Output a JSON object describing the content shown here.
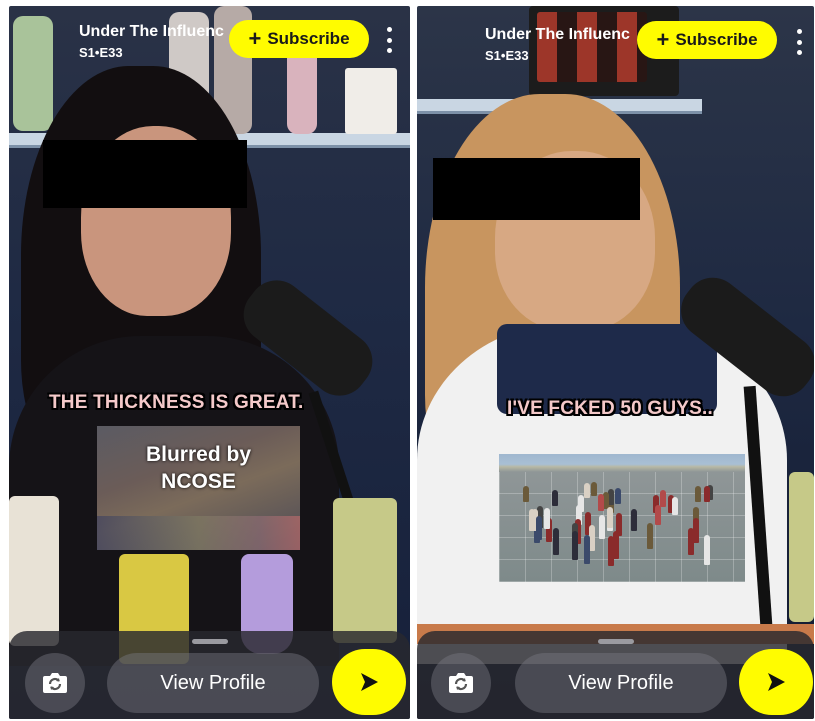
{
  "panels": [
    {
      "show_title": "Under The Influenc",
      "episode": "S1•E33",
      "subscribe_label": "Subscribe",
      "subscribe_plus": "+",
      "caption": "THE THICKNESS IS GREAT.",
      "overlay_text": "Blurred by\nNCOSE",
      "view_profile_label": "View Profile"
    },
    {
      "show_title": "Under The Influenc",
      "episode": "S1•E33",
      "subscribe_label": "Subscribe",
      "subscribe_plus": "+",
      "caption": "I'VE FCKED 50 GUYS..",
      "view_profile_label": "View Profile"
    }
  ],
  "colors": {
    "accent": "#fffc00",
    "caption": "#f4c9c9",
    "censor": "#000000"
  },
  "icons": {
    "camera_flip": "camera-flip-icon",
    "send": "send-arrow-icon",
    "more": "more-vertical-icon"
  }
}
